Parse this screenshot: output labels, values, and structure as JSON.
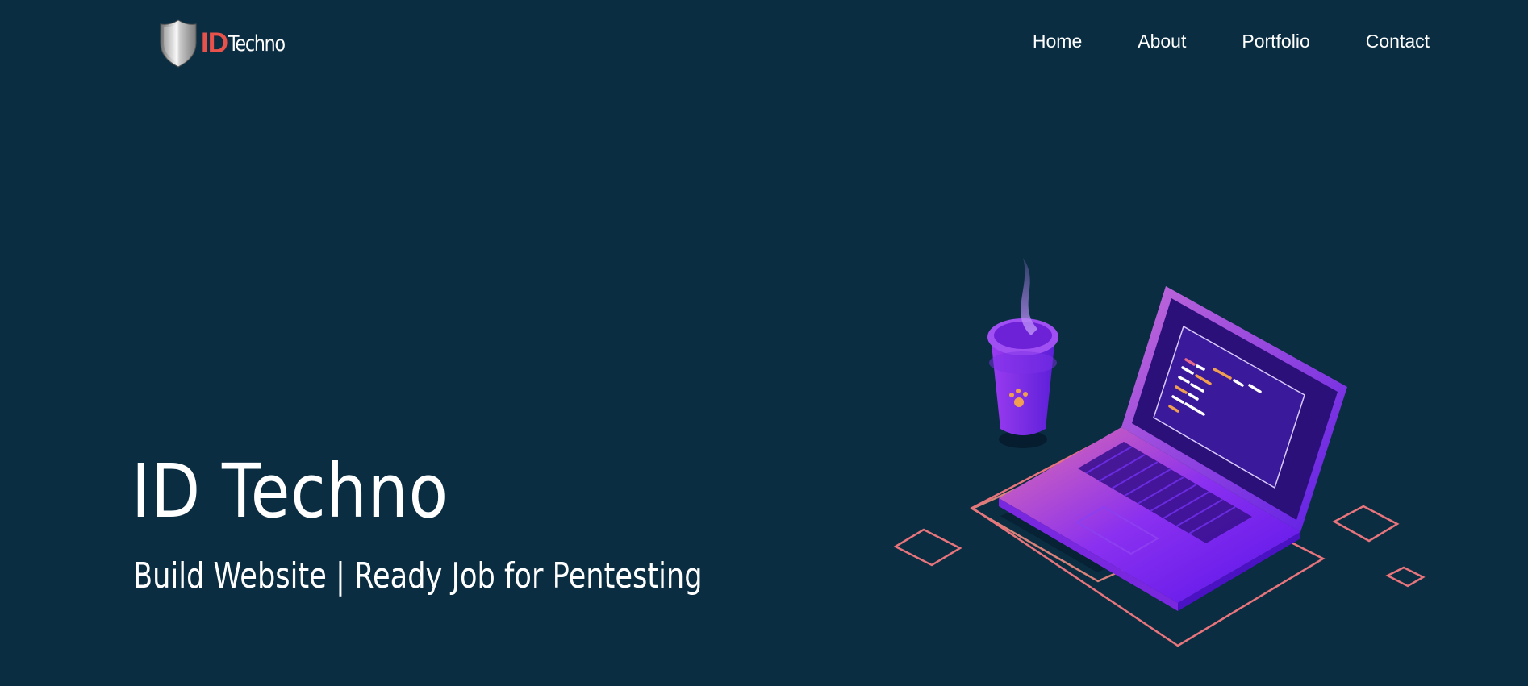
{
  "logo": {
    "id_text": "ID",
    "techno_text": "Techno",
    "id_color": "#e8524a",
    "shield_icon": "shield-icon"
  },
  "nav": {
    "items": [
      {
        "label": "Home"
      },
      {
        "label": "About"
      },
      {
        "label": "Portfolio"
      },
      {
        "label": "Contact"
      }
    ]
  },
  "hero": {
    "title": "ID Techno",
    "subtitle": "Build Website | Ready Job for Pentesting"
  },
  "illustration": {
    "subject": "laptop-and-coffee-cup-illustration",
    "accent_colors": [
      "#7b2ff7",
      "#b44cf0",
      "#e8747c",
      "#f0a050"
    ]
  },
  "colors": {
    "background": "#0a2d42",
    "text": "#ffffff"
  }
}
